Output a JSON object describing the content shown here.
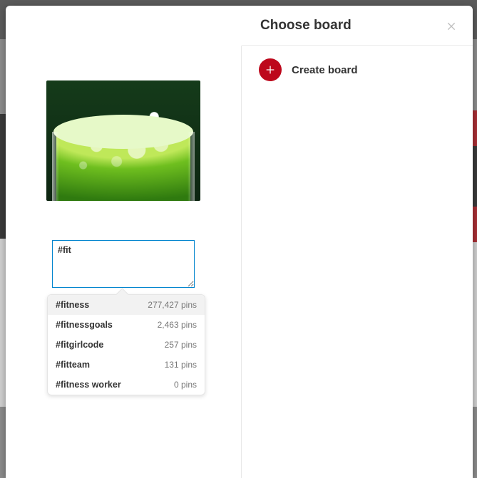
{
  "header": {
    "title": "Choose board"
  },
  "create": {
    "label": "Create board"
  },
  "description": {
    "value": "#fit"
  },
  "suggestions": [
    {
      "tag": "#fitness",
      "count": "277,427 pins",
      "selected": true
    },
    {
      "tag": "#fitnessgoals",
      "count": "2,463 pins",
      "selected": false
    },
    {
      "tag": "#fitgirlcode",
      "count": "257 pins",
      "selected": false
    },
    {
      "tag": "#fitteam",
      "count": "131 pins",
      "selected": false
    },
    {
      "tag": "#fitness worker",
      "count": "0 pins",
      "selected": false
    }
  ]
}
